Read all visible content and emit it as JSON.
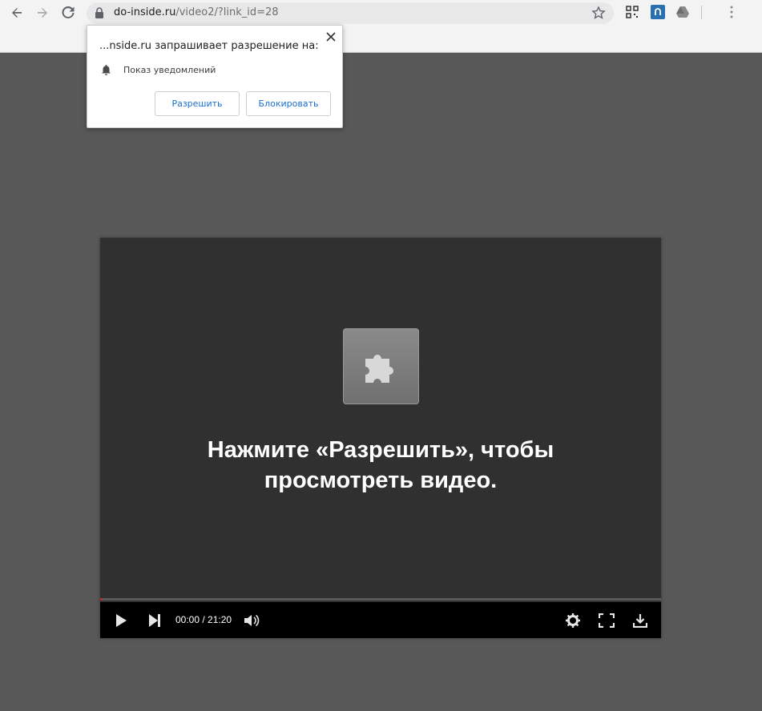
{
  "browser": {
    "url_host": "do-inside.ru",
    "url_path": "/video2/?link_id=28"
  },
  "popup": {
    "title": "...nside.ru запрашивает разрешение на:",
    "permission_label": "Показ уведомлений",
    "allow_label": "Разрешить",
    "block_label": "Блокировать"
  },
  "player": {
    "message_line1": "Нажмите «Разрешить», чтобы",
    "message_line2": "просмотреть видео.",
    "time_display": "00:00 / 21:20",
    "progress_fraction": 0.003
  }
}
